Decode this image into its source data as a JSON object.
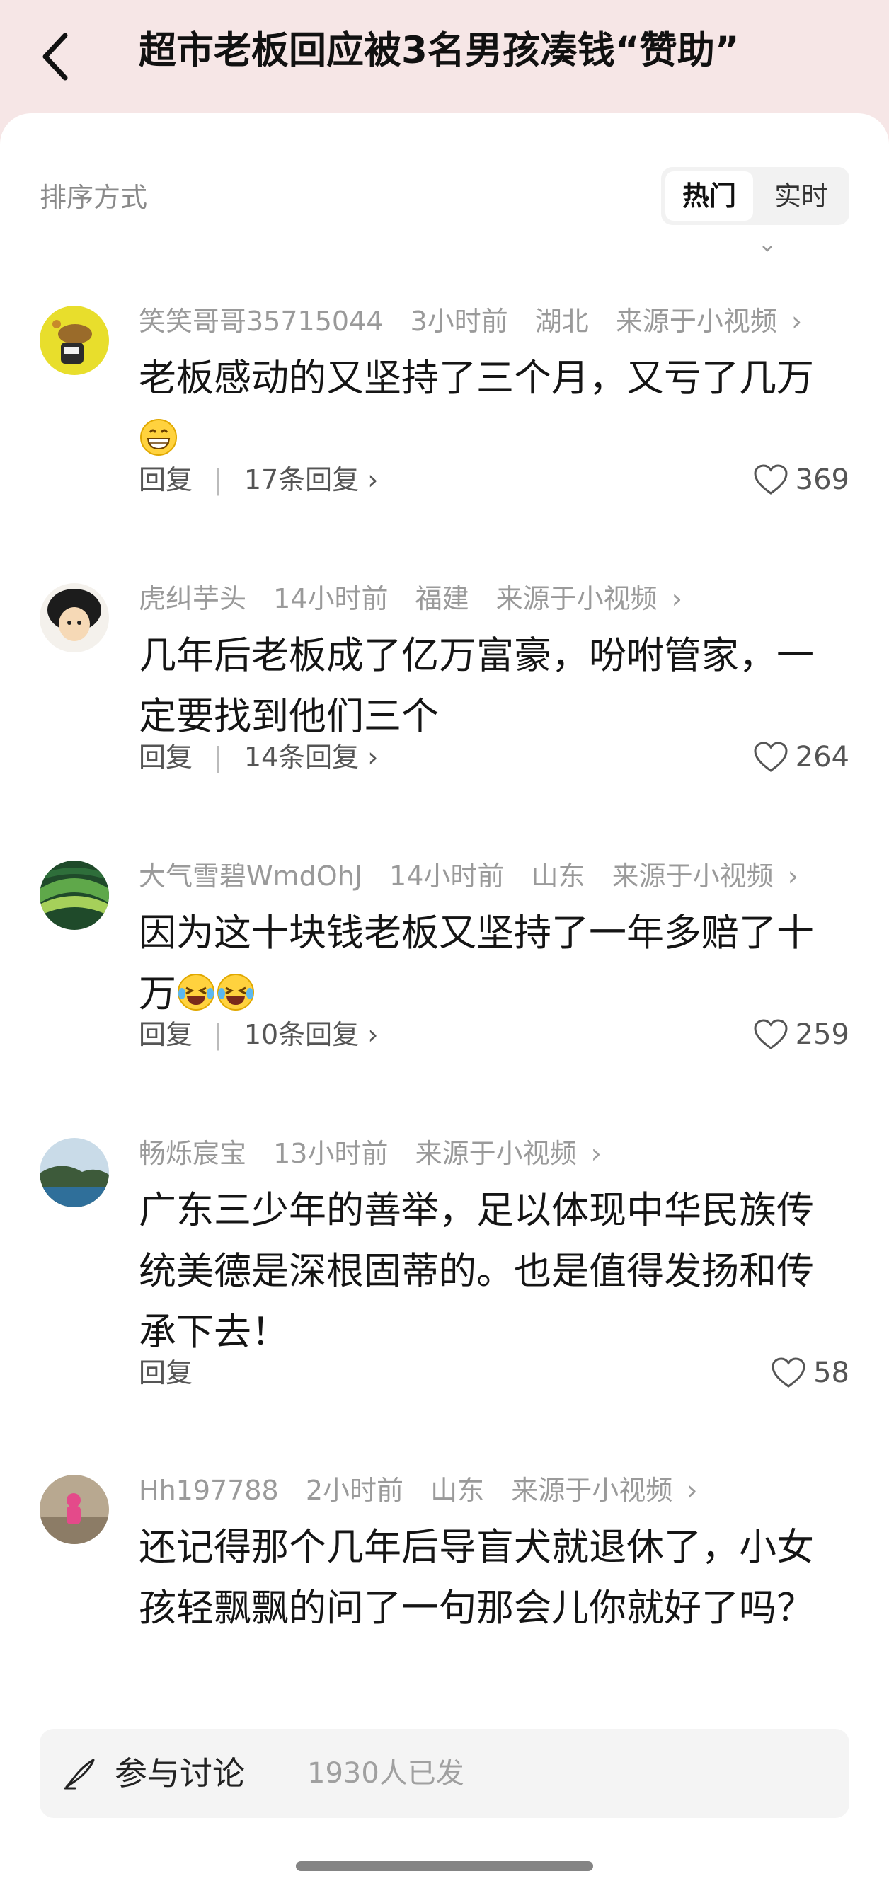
{
  "header": {
    "title": "超市老板回应被3名男孩凑钱“赞助”"
  },
  "sort": {
    "label": "排序方式",
    "options": [
      "热门",
      "实时"
    ],
    "selected": "热门"
  },
  "comments": [
    {
      "user": "笑笑哥哥35715044",
      "time": "3小时前",
      "location": "湖北",
      "source": "来源于小视频",
      "text": "老板感动的又坚持了三个月，又亏了几万",
      "emoji": "grin-emoji",
      "reply_label": "回复",
      "replies": "17条回复",
      "likes": "369"
    },
    {
      "user": "虎纠芋头",
      "time": "14小时前",
      "location": "福建",
      "source": "来源于小视频",
      "text": "几年后老板成了亿万富豪，吩咐管家，一定要找到他们三个",
      "reply_label": "回复",
      "replies": "14条回复",
      "likes": "264"
    },
    {
      "user": "大气雪碧WmdOhJ",
      "time": "14小时前",
      "location": "山东",
      "source": "来源于小视频",
      "text": "因为这十块钱老板又坚持了一年多赔了十万",
      "emoji": "laugh-cry-emoji",
      "reply_label": "回复",
      "replies": "10条回复",
      "likes": "259"
    },
    {
      "user": "畅烁宸宝",
      "time": "13小时前",
      "location": "",
      "source": "来源于小视频",
      "text": "广东三少年的善举，足以体现中华民族传统美德是深根固蒂的。也是值得发扬和传承下去！",
      "reply_label": "回复",
      "likes": "58"
    },
    {
      "user": "Hh197788",
      "time": "2小时前",
      "location": "山东",
      "source": "来源于小视频",
      "text": "还记得那个几年后导盲犬就退休了，小女孩轻飘飘的问了一句那会儿你就好了吗？"
    }
  ],
  "discuss": {
    "label": "参与讨论",
    "count": "1930人已发"
  }
}
